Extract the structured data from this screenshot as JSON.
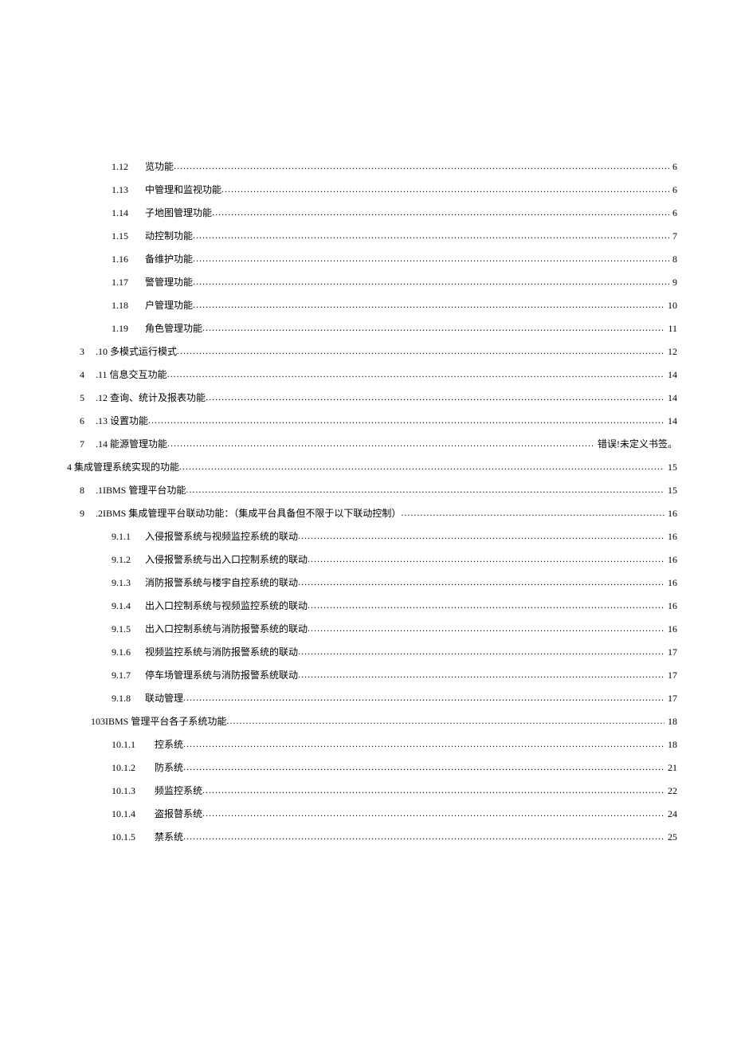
{
  "toc": [
    {
      "level": 2,
      "num": "1.12",
      "title": "览功能",
      "page": "6"
    },
    {
      "level": 2,
      "num": "1.13",
      "title": "中管理和监视功能",
      "page": "6"
    },
    {
      "level": 2,
      "num": "1.14",
      "title": "子地图管理功能",
      "page": "6"
    },
    {
      "level": 2,
      "num": "1.15",
      "title": "动控制功能",
      "page": "7"
    },
    {
      "level": 2,
      "num": "1.16",
      "title": "备维护功能",
      "page": "8"
    },
    {
      "level": 2,
      "num": "1.17",
      "title": "警管理功能",
      "page": "9"
    },
    {
      "level": 2,
      "num": "1.18",
      "title": "户管理功能",
      "page": "10"
    },
    {
      "level": 2,
      "num": "1.19",
      "title": "角色管理功能",
      "page": "11"
    },
    {
      "level": 1,
      "num": "3",
      "title": ".10 多模式运行模式",
      "page": "12"
    },
    {
      "level": 1,
      "num": "4",
      "title": ".11 信息交互功能",
      "page": "14"
    },
    {
      "level": 1,
      "num": "5",
      "title": ".12 查询、统计及报表功能",
      "page": "14"
    },
    {
      "level": 1,
      "num": "6",
      "title": ".13 设置功能",
      "page": "14"
    },
    {
      "level": 1,
      "num": "7",
      "title": ".14 能源管理功能",
      "page": "错误!未定义书签。"
    },
    {
      "level": 0,
      "num": "",
      "title": "4 集成管理系统实现的功能",
      "page": "15"
    },
    {
      "level": 1,
      "num": "8",
      "title": ".1IBMS 管理平台功能",
      "page": "15"
    },
    {
      "level": 1,
      "num": "9",
      "title": ".2IBMS 集成管理平台联动功能：（集成平台具备但不限于以下联动控制）",
      "page": "16"
    },
    {
      "level": 2,
      "num": "9.1.1",
      "title": "入侵报警系统与视频监控系统的联动",
      "page": "16"
    },
    {
      "level": 2,
      "num": "9.1.2",
      "title": "入侵报警系统与出入口控制系统的联动",
      "page": "16"
    },
    {
      "level": 2,
      "num": "9.1.3",
      "title": "消防报警系统与楼宇自控系统的联动",
      "page": "16"
    },
    {
      "level": 2,
      "num": "9.1.4",
      "title": "出入口控制系统与视频监控系统的联动",
      "page": "16"
    },
    {
      "level": 2,
      "num": "9.1.5",
      "title": "出入口控制系统与消防报警系统的联动",
      "page": "16"
    },
    {
      "level": 2,
      "num": "9.1.6",
      "title": "视频监控系统与消防报警系统的联动",
      "page": "17"
    },
    {
      "level": 2,
      "num": "9.1.7",
      "title": "停车场管理系统与消防报警系统联动",
      "page": "17"
    },
    {
      "level": 2,
      "num": "9.1.8",
      "title": "联动管理",
      "page": "17"
    },
    {
      "level": 1,
      "num": "",
      "title": "103IBMS 管理平台各子系统功能",
      "page": "18"
    },
    {
      "level": 3,
      "num": "10.1.1",
      "title": "控系统",
      "page": "18"
    },
    {
      "level": 3,
      "num": "10.1.2",
      "title": "防系统",
      "page": "21"
    },
    {
      "level": 3,
      "num": "10.1.3",
      "title": "频监控系统",
      "page": "22"
    },
    {
      "level": 3,
      "num": "10.1.4",
      "title": "盗报瞽系统",
      "page": "24"
    },
    {
      "level": 3,
      "num": "10.1.5",
      "title": "禁系统",
      "page": "25"
    }
  ]
}
